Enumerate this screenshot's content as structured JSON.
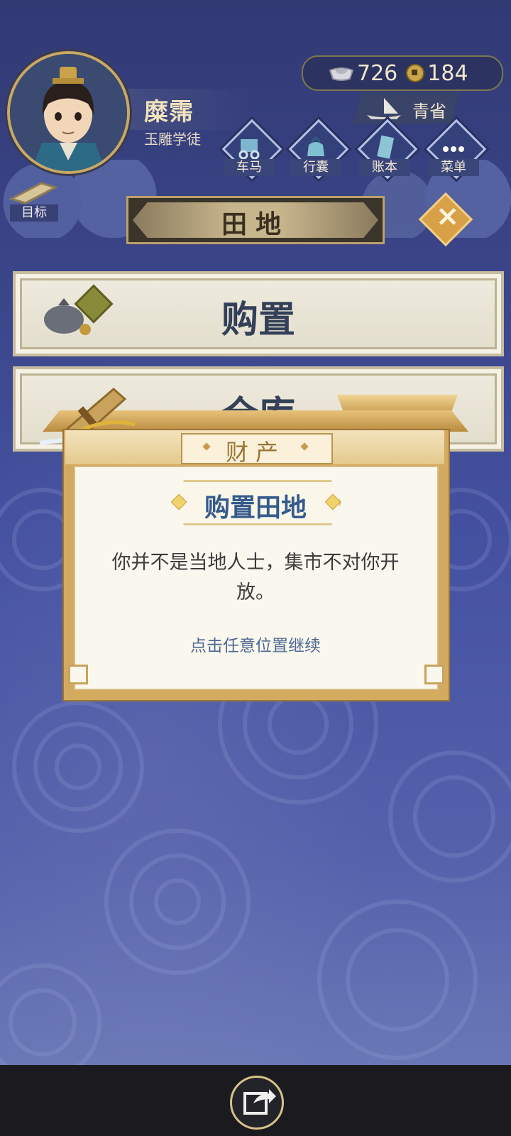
{
  "player": {
    "name": "糜霈",
    "title": "玉雕学徒"
  },
  "currency": {
    "silver": "726",
    "coins": "184"
  },
  "location": "青省",
  "toolbar": [
    {
      "label": "车马",
      "icon": "carriage-icon"
    },
    {
      "label": "行囊",
      "icon": "bag-icon"
    },
    {
      "label": "账本",
      "icon": "ledger-icon"
    },
    {
      "label": "菜单",
      "icon": "more-icon"
    }
  ],
  "goal": {
    "label": "目标"
  },
  "page": {
    "title": "田地"
  },
  "menu": [
    {
      "label": "购置"
    },
    {
      "label": "仓库"
    }
  ],
  "dialog": {
    "header": "财产",
    "title": "购置田地",
    "message": "你并不是当地人士，集市不对你开放。",
    "hint": "点击任意位置继续"
  },
  "colors": {
    "accent_gold": "#d3aa5f",
    "title_blue": "#355a8c",
    "bg_blue": "#3a4487"
  }
}
